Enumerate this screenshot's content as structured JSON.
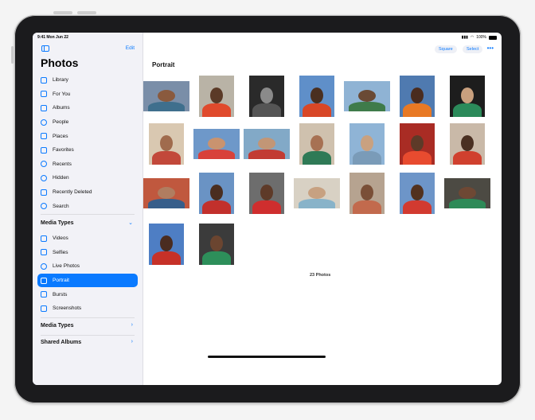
{
  "status": {
    "time": "9:41 Mon Jun 22",
    "battery": "100%"
  },
  "sidebar": {
    "title": "Photos",
    "edit_label": "Edit",
    "items": [
      {
        "label": "Library",
        "icon": "library-icon"
      },
      {
        "label": "For You",
        "icon": "for-you-icon"
      },
      {
        "label": "Albums",
        "icon": "albums-icon"
      },
      {
        "label": "People",
        "icon": "people-icon"
      },
      {
        "label": "Places",
        "icon": "places-icon"
      },
      {
        "label": "Favorites",
        "icon": "heart-icon"
      },
      {
        "label": "Recents",
        "icon": "clock-icon"
      },
      {
        "label": "Hidden",
        "icon": "eye-icon"
      },
      {
        "label": "Recently Deleted",
        "icon": "trash-icon"
      },
      {
        "label": "Search",
        "icon": "search-icon"
      }
    ],
    "media_types_header": "Media Types",
    "media_items": [
      {
        "label": "Videos",
        "icon": "video-icon"
      },
      {
        "label": "Selfies",
        "icon": "selfie-icon"
      },
      {
        "label": "Live Photos",
        "icon": "live-photo-icon"
      },
      {
        "label": "Portrait",
        "icon": "cube-icon",
        "active": true
      },
      {
        "label": "Bursts",
        "icon": "bursts-icon"
      },
      {
        "label": "Screenshots",
        "icon": "screenshot-icon"
      }
    ],
    "sections": [
      {
        "label": "Media Types"
      },
      {
        "label": "Shared Albums"
      }
    ]
  },
  "toolbar": {
    "square_label": "Square",
    "select_label": "Select",
    "more_label": "•••"
  },
  "content": {
    "title": "Portrait",
    "photo_count": "23 Photos",
    "photos": [
      {
        "bg": "#7a8ea8",
        "face": "#8a5a3e",
        "body": "#3f6f8d"
      },
      {
        "bg": "#b9b3a6",
        "face": "#5b3a27",
        "body": "#e04a2c"
      },
      {
        "bg": "#2a2a2a",
        "face": "#8a8a8a",
        "body": "#555"
      },
      {
        "bg": "#5f8fc9",
        "face": "#4a2f20",
        "body": "#d84727"
      },
      {
        "bg": "#8fb3d4",
        "face": "#6a4a35",
        "body": "#3f7b4a"
      },
      {
        "bg": "#4f7ab0",
        "face": "#4a2c1f",
        "body": "#e87924"
      },
      {
        "bg": "#1d1d1d",
        "face": "#c9a07e",
        "body": "#2b8a5a"
      },
      {
        "bg": "#d9c8b1",
        "face": "#a06b4d",
        "body": "#c2483a"
      },
      {
        "bg": "#6e98c9",
        "face": "#c9936f",
        "body": "#d8413a"
      },
      {
        "bg": "#82a9c7",
        "face": "#c29676",
        "body": "#c23b33"
      },
      {
        "bg": "#cfc1ae",
        "face": "#a77153",
        "body": "#2f7a56"
      },
      {
        "bg": "#8fb4d6",
        "face": "#c9a180",
        "body": "#7a9bb8"
      },
      {
        "bg": "#a92c24",
        "face": "#5d3a28",
        "body": "#e84b2f"
      },
      {
        "bg": "#c9b9a8",
        "face": "#4a3022",
        "body": "#d0402e"
      },
      {
        "bg": "#c0583e",
        "face": "#b07d60",
        "body": "#375e8a"
      },
      {
        "bg": "#6a93c4",
        "face": "#4a2e20",
        "body": "#c2302c"
      },
      {
        "bg": "#6d6d6d",
        "face": "#5e3a28",
        "body": "#cf2e2e"
      },
      {
        "bg": "#d8d1c4",
        "face": "#c7a181",
        "body": "#88b3c9"
      },
      {
        "bg": "#b6a390",
        "face": "#7a4f37",
        "body": "#c26a4d"
      },
      {
        "bg": "#6d95c8",
        "face": "#52321f",
        "body": "#d23a30"
      },
      {
        "bg": "#4c4a43",
        "face": "#6e4834",
        "body": "#2d8a57"
      },
      {
        "bg": "#4e7ec4",
        "face": "#4a2c20",
        "body": "#c63128"
      },
      {
        "bg": "#3b3b3b",
        "face": "#6b4530",
        "body": "#2d8f5a"
      }
    ]
  }
}
